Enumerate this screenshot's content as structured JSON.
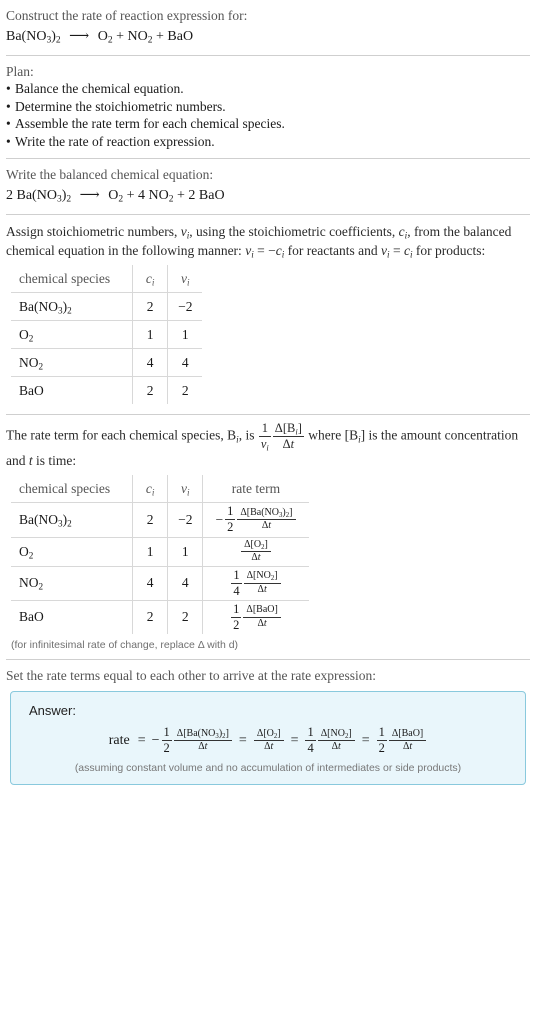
{
  "question": {
    "prompt": "Construct the rate of reaction expression for:",
    "equation": {
      "reactants": [
        {
          "coeff": "",
          "formula_parts": [
            {
              "t": "Ba(NO"
            },
            {
              "sub": "3"
            },
            {
              "t": ")"
            },
            {
              "sub": "2"
            }
          ]
        }
      ],
      "display": "Ba(NO3)2 ⟶ O2 + NO2 + BaO"
    }
  },
  "plan": {
    "heading": "Plan:",
    "steps": [
      "Balance the chemical equation.",
      "Determine the stoichiometric numbers.",
      "Assemble the rate term for each chemical species.",
      "Write the rate of reaction expression."
    ]
  },
  "balanced": {
    "heading": "Write the balanced chemical equation:",
    "display": "2 Ba(NO3)2 ⟶ O2 + 4 NO2 + 2 BaO",
    "reactant_coeff": "2",
    "o2_coeff": "",
    "no2_coeff": "4",
    "bao_coeff": "2"
  },
  "assign": {
    "text_1": "Assign stoichiometric numbers, ",
    "text_2": ", using the stoichiometric coefficients, ",
    "text_3": ", from the balanced chemical equation in the following manner: ",
    "text_4": " for reactants and ",
    "text_5": " for products:"
  },
  "table1": {
    "headers": [
      "chemical species",
      "c",
      "v"
    ],
    "rows": [
      {
        "species": "Ba(NO3)2",
        "c": "2",
        "v": "−2"
      },
      {
        "species": "O2",
        "c": "1",
        "v": "1"
      },
      {
        "species": "NO2",
        "c": "4",
        "v": "4"
      },
      {
        "species": "BaO",
        "c": "2",
        "v": "2"
      }
    ]
  },
  "rate_intro": {
    "text_1": "The rate term for each chemical species, B",
    "text_2": ", is ",
    "text_3": " where [B",
    "text_4": "] is the amount concentration and ",
    "text_5": " is time:"
  },
  "table2": {
    "headers": [
      "chemical species",
      "c",
      "v",
      "rate term"
    ],
    "rows": [
      {
        "species": "Ba(NO3)2",
        "c": "2",
        "v": "−2",
        "sign": "−",
        "num": "1",
        "den": "2",
        "delta": "Δ[Ba(NO3)2]",
        "dt": "Δt"
      },
      {
        "species": "O2",
        "c": "1",
        "v": "1",
        "sign": "",
        "num": "",
        "den": "",
        "delta": "Δ[O2]",
        "dt": "Δt"
      },
      {
        "species": "NO2",
        "c": "4",
        "v": "4",
        "sign": "",
        "num": "1",
        "den": "4",
        "delta": "Δ[NO2]",
        "dt": "Δt"
      },
      {
        "species": "BaO",
        "c": "2",
        "v": "2",
        "sign": "",
        "num": "1",
        "den": "2",
        "delta": "Δ[BaO]",
        "dt": "Δt"
      }
    ],
    "footnote": "(for infinitesimal rate of change, replace Δ with d)"
  },
  "final": {
    "heading": "Set the rate terms equal to each other to arrive at the rate expression:",
    "answer_label": "Answer:",
    "rate_word": "rate",
    "equals": "=",
    "terms": [
      {
        "sign": "−",
        "num": "1",
        "den": "2",
        "delta": "Δ[Ba(NO3)2]",
        "dt": "Δt"
      },
      {
        "sign": "",
        "num": "",
        "den": "",
        "delta": "Δ[O2]",
        "dt": "Δt"
      },
      {
        "sign": "",
        "num": "1",
        "den": "4",
        "delta": "Δ[NO2]",
        "dt": "Δt"
      },
      {
        "sign": "",
        "num": "1",
        "den": "2",
        "delta": "Δ[BaO]",
        "dt": "Δt"
      }
    ],
    "assumption": "(assuming constant volume and no accumulation of intermediates or side products)"
  },
  "colors": {
    "answer_bg": "#e9f6fb",
    "answer_border": "#89c9dd",
    "divider": "#cfcfcf",
    "muted_text": "#555555"
  }
}
